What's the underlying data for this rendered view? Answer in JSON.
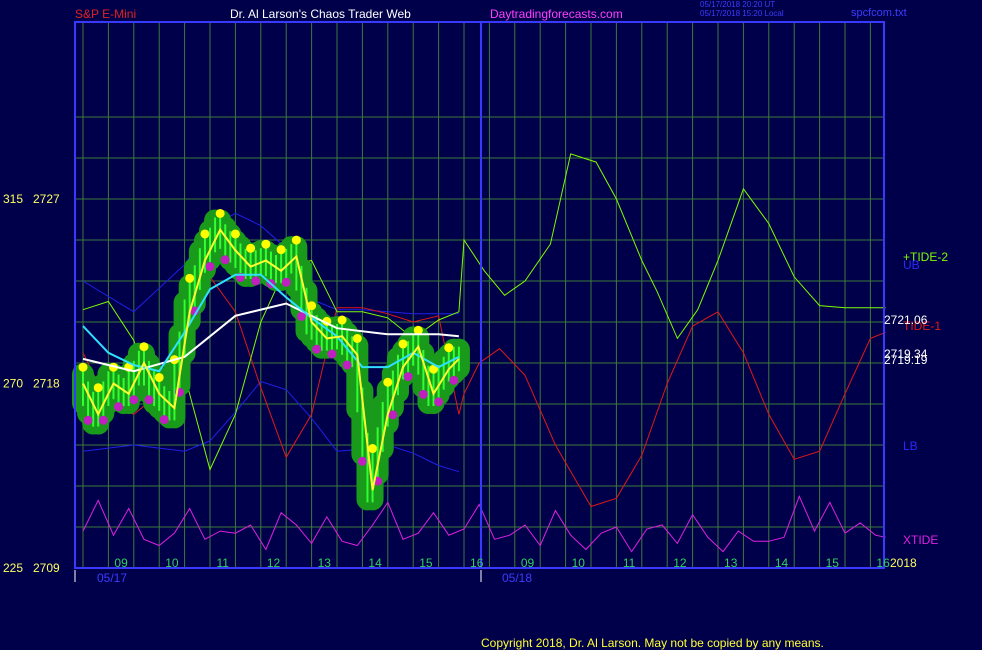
{
  "header": {
    "symbol": "S&P E-Mini",
    "title": "Dr. Al Larson's Chaos Trader Web",
    "site": "Daytradingforecasts.com",
    "timestamp_utc": "05/17/2018 20:20 UT",
    "timestamp_local": "05/17/2018 15:20 Local",
    "filename": "spcfcom.txt"
  },
  "footer": {
    "copyright": "Copyright 2018, Dr. Al Larson. May not be copied by any means."
  },
  "colors": {
    "background": "#00004a",
    "grid": "#3c7a3c",
    "frame": "#3838ff",
    "tide2": "#7cfc00",
    "tide1": "#e01818",
    "xtide": "#e020e0",
    "bands": "#2020e8",
    "price": "#ffff30",
    "avg_fast": "#30e0ff",
    "avg_slow": "#ffffff",
    "bar": "#30ff30",
    "halo": "#1a9a1a",
    "dot_high": "#ffff00",
    "dot_low": "#c020c0"
  },
  "chart_data": {
    "type": "line",
    "title": "S&P E-Mini",
    "y_axis": {
      "range": [
        2709,
        2727
      ],
      "ticks": [
        {
          "left": "315",
          "right": "2727",
          "value": 2727
        },
        {
          "left": "270",
          "right": "2718",
          "value": 2718
        },
        {
          "left": "225",
          "right": "2709",
          "value": 2709
        }
      ]
    },
    "x_axis": {
      "hour_labels": [
        "09",
        "10",
        "11",
        "12",
        "13",
        "14",
        "15",
        "16",
        "09",
        "10",
        "11",
        "12",
        "13",
        "14",
        "15",
        "16"
      ],
      "date_labels": [
        "05/17",
        "05/18"
      ],
      "year_label": "2018"
    },
    "right_labels": {
      "tide2": "+TIDE-2",
      "ub": "UB",
      "tide1": "TIDE-1",
      "lb": "LB",
      "xtide": "XTIDE",
      "value_1": "2721.06",
      "value_2": "2719.34",
      "value_3": "2719.19"
    },
    "series": [
      {
        "name": "price",
        "x": [
          0,
          0.3,
          0.6,
          0.9,
          1.2,
          1.5,
          1.8,
          2.1,
          2.4,
          2.7,
          3.0,
          3.3,
          3.6,
          3.9,
          4.2,
          4.5,
          4.8,
          5.1,
          5.4,
          5.7,
          6.0,
          6.3,
          6.6,
          6.9,
          7.2,
          7.4
        ],
        "y": [
          2718,
          2716.5,
          2718,
          2717.5,
          2719,
          2717.5,
          2716.8,
          2721.5,
          2724,
          2725.5,
          2724.5,
          2723.7,
          2724,
          2723.5,
          2724.2,
          2721,
          2720.2,
          2720.3,
          2719.4,
          2712.8,
          2716.5,
          2718.8,
          2719.8,
          2717.5,
          2718.7,
          2719.2
        ]
      },
      {
        "name": "avg_fast",
        "x": [
          0,
          0.5,
          1.0,
          1.5,
          2.0,
          2.5,
          3.0,
          3.5,
          4.0,
          4.5,
          5.0,
          5.5,
          6.0,
          6.5,
          7.0,
          7.4
        ],
        "y": [
          2720.8,
          2719.5,
          2718.9,
          2718.6,
          2720.5,
          2722.6,
          2723.3,
          2723.3,
          2722.2,
          2721.2,
          2720.3,
          2718.8,
          2718.8,
          2719.5,
          2718.8,
          2719.3
        ]
      },
      {
        "name": "avg_slow",
        "x": [
          0,
          1.0,
          2.0,
          3.0,
          4.0,
          5.0,
          6.0,
          7.0,
          7.4
        ],
        "y": [
          2719.2,
          2718.6,
          2719.3,
          2721.3,
          2721.9,
          2720.7,
          2720.4,
          2720.4,
          2720.3
        ]
      },
      {
        "name": "tide2",
        "x": [
          0,
          0.5,
          1,
          1.5,
          2,
          2.5,
          3,
          3.5,
          4,
          4.5,
          5,
          5.5,
          6,
          6.5,
          7,
          7.4,
          7.5,
          7.9,
          8.3,
          8.7,
          9.2,
          9.6,
          10.1,
          10.5,
          11,
          11.3,
          11.7,
          12.1,
          12.5,
          13,
          13.5,
          14,
          14.5,
          15,
          15.5,
          15.8
        ],
        "y": [
          2721.6,
          2722,
          2720.1,
          2716.5,
          2718.4,
          2713.8,
          2716.5,
          2721,
          2723.7,
          2724,
          2721.5,
          2721.5,
          2721.2,
          2720.2,
          2721.1,
          2721.5,
          2725,
          2723.5,
          2722.3,
          2723,
          2724.8,
          2729.2,
          2728.8,
          2727,
          2724,
          2722.5,
          2720.2,
          2721.6,
          2724,
          2727.5,
          2725.8,
          2723.2,
          2721.8,
          2721.7,
          2721.7,
          2721.7
        ]
      },
      {
        "name": "tide1",
        "x": [
          0,
          0.5,
          1,
          1.5,
          2,
          2.5,
          3,
          3.5,
          4,
          4.5,
          5,
          5.5,
          6,
          6.5,
          7,
          7.4,
          7.5,
          7.8,
          8.2,
          8.7,
          9.3,
          10,
          10.5,
          11,
          11.5,
          12,
          12.5,
          13,
          13.5,
          14,
          14.5,
          15,
          15.5,
          15.8
        ],
        "y": [
          2719.5,
          2717,
          2716.5,
          2717.5,
          2719.7,
          2723.2,
          2721.5,
          2717.8,
          2714.4,
          2716.5,
          2721.7,
          2721.7,
          2721.4,
          2721,
          2721.3,
          2716.5,
          2717.5,
          2719,
          2719.7,
          2718.4,
          2715,
          2712,
          2712.4,
          2714.5,
          2718,
          2720.8,
          2721.5,
          2719.5,
          2716.5,
          2714.3,
          2714.7,
          2717.5,
          2720.2,
          2720.5
        ]
      },
      {
        "name": "xtide",
        "x": [
          0,
          0.3,
          0.6,
          0.9,
          1.2,
          1.5,
          1.8,
          2.1,
          2.4,
          2.7,
          3.0,
          3.3,
          3.6,
          3.9,
          4.2,
          4.5,
          4.8,
          5.1,
          5.4,
          5.7,
          6.0,
          6.3,
          6.6,
          6.9,
          7.2,
          7.5,
          7.8,
          8.1,
          8.4,
          8.7,
          9.0,
          9.3,
          9.6,
          9.9,
          10.2,
          10.5,
          10.8,
          11.1,
          11.4,
          11.7,
          12.0,
          12.3,
          12.6,
          12.9,
          13.2,
          13.5,
          13.8,
          14.1,
          14.4,
          14.7,
          15.0,
          15.3,
          15.6,
          15.8
        ],
        "y": [
          2710.8,
          2712.3,
          2710.6,
          2711.9,
          2710.4,
          2710.1,
          2710.7,
          2711.9,
          2710.4,
          2710.8,
          2710.7,
          2711.1,
          2709.9,
          2711.7,
          2711.1,
          2710.2,
          2711.5,
          2710.3,
          2710.1,
          2711.1,
          2712.2,
          2710.4,
          2710.7,
          2711.7,
          2710.6,
          2710.9,
          2712.1,
          2710.4,
          2710.6,
          2711.1,
          2710.1,
          2711.8,
          2710.6,
          2709.9,
          2710.7,
          2711,
          2709.8,
          2710.9,
          2711.1,
          2710.2,
          2711.6,
          2710.5,
          2709.8,
          2710.8,
          2710.3,
          2710.3,
          2710.5,
          2712.5,
          2710.8,
          2712.2,
          2710.7,
          2711.2,
          2710.6,
          2710.5
        ]
      },
      {
        "name": "ub",
        "x": [
          0,
          1,
          2,
          2.5,
          3,
          3.5,
          4,
          4.5,
          5,
          5.5,
          6,
          6.5,
          7,
          7.4
        ],
        "y": [
          2723,
          2721.5,
          2723.8,
          2725.6,
          2726.3,
          2725.7,
          2724.6,
          2722.1,
          2721.6,
          2721.6,
          2721.5,
          2721.4,
          2721.4,
          2721.4
        ]
      },
      {
        "name": "lb",
        "x": [
          0,
          1,
          2,
          2.5,
          3,
          3.5,
          4,
          4.5,
          5,
          5.5,
          6,
          6.5,
          7,
          7.4
        ],
        "y": [
          2714.7,
          2715,
          2714.7,
          2715.2,
          2716.6,
          2718.1,
          2717.7,
          2716.3,
          2714.7,
          2714.8,
          2715,
          2714.6,
          2714,
          2713.7
        ]
      }
    ]
  }
}
